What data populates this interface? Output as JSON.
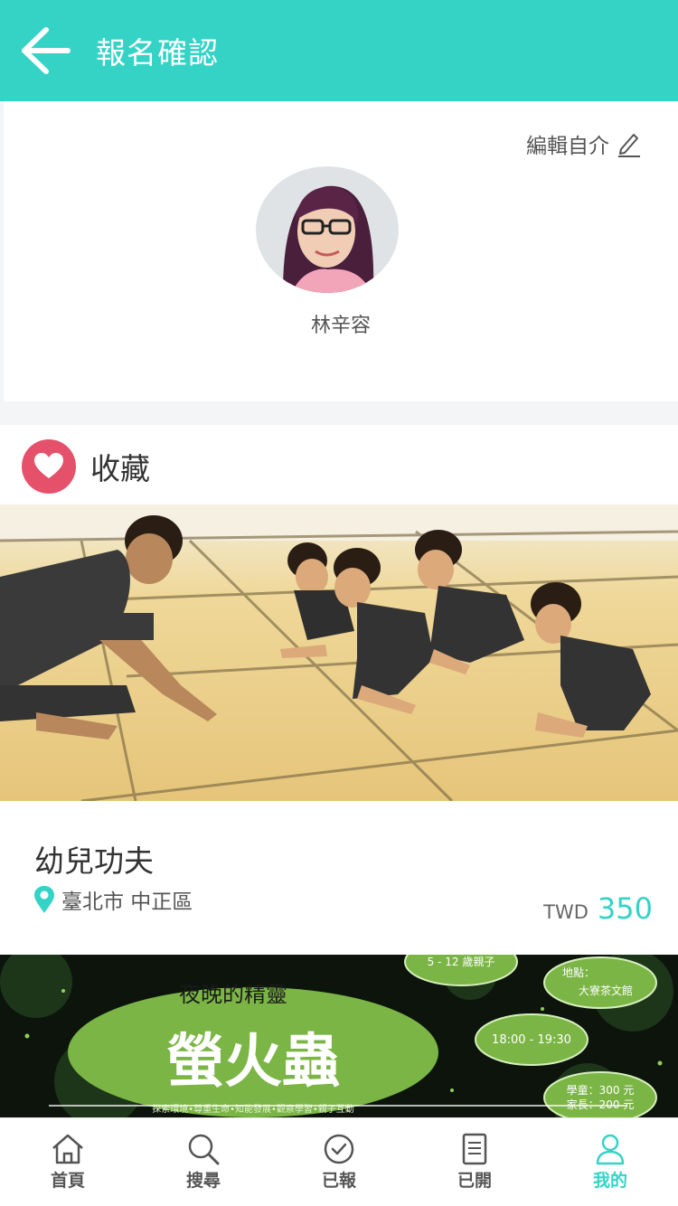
{
  "header": {
    "title": "報名確認",
    "back_icon": "arrow-left-icon",
    "bg": "#35d3c6"
  },
  "profile": {
    "edit_label": "編輯自介",
    "name": "林辛容"
  },
  "favorites": {
    "label": "收藏",
    "card": {
      "title": "幼兒功夫",
      "location": "臺北市 中正區",
      "currency": "TWD",
      "price": "350"
    },
    "card2": {
      "age": "5 - 12 歲親子",
      "subtitle": "夜晚的精靈",
      "title": "螢火蟲",
      "location_label": "地點：",
      "location": "大寮茶文館",
      "time": "18:00 - 19:30",
      "price_child": "學童：300 元",
      "price_parent": "家長：200 元",
      "tags": "探索環境•尊重生命•知能發展•觀察學習•親子互動"
    }
  },
  "tabs": [
    {
      "label": "首頁",
      "icon": "home-icon"
    },
    {
      "label": "搜尋",
      "icon": "search-icon"
    },
    {
      "label": "已報",
      "icon": "check-circle-icon"
    },
    {
      "label": "已開",
      "icon": "document-icon"
    },
    {
      "label": "我的",
      "icon": "user-icon",
      "active": true
    }
  ],
  "colors": {
    "accent": "#35d3c6",
    "heart": "#e5506a"
  }
}
